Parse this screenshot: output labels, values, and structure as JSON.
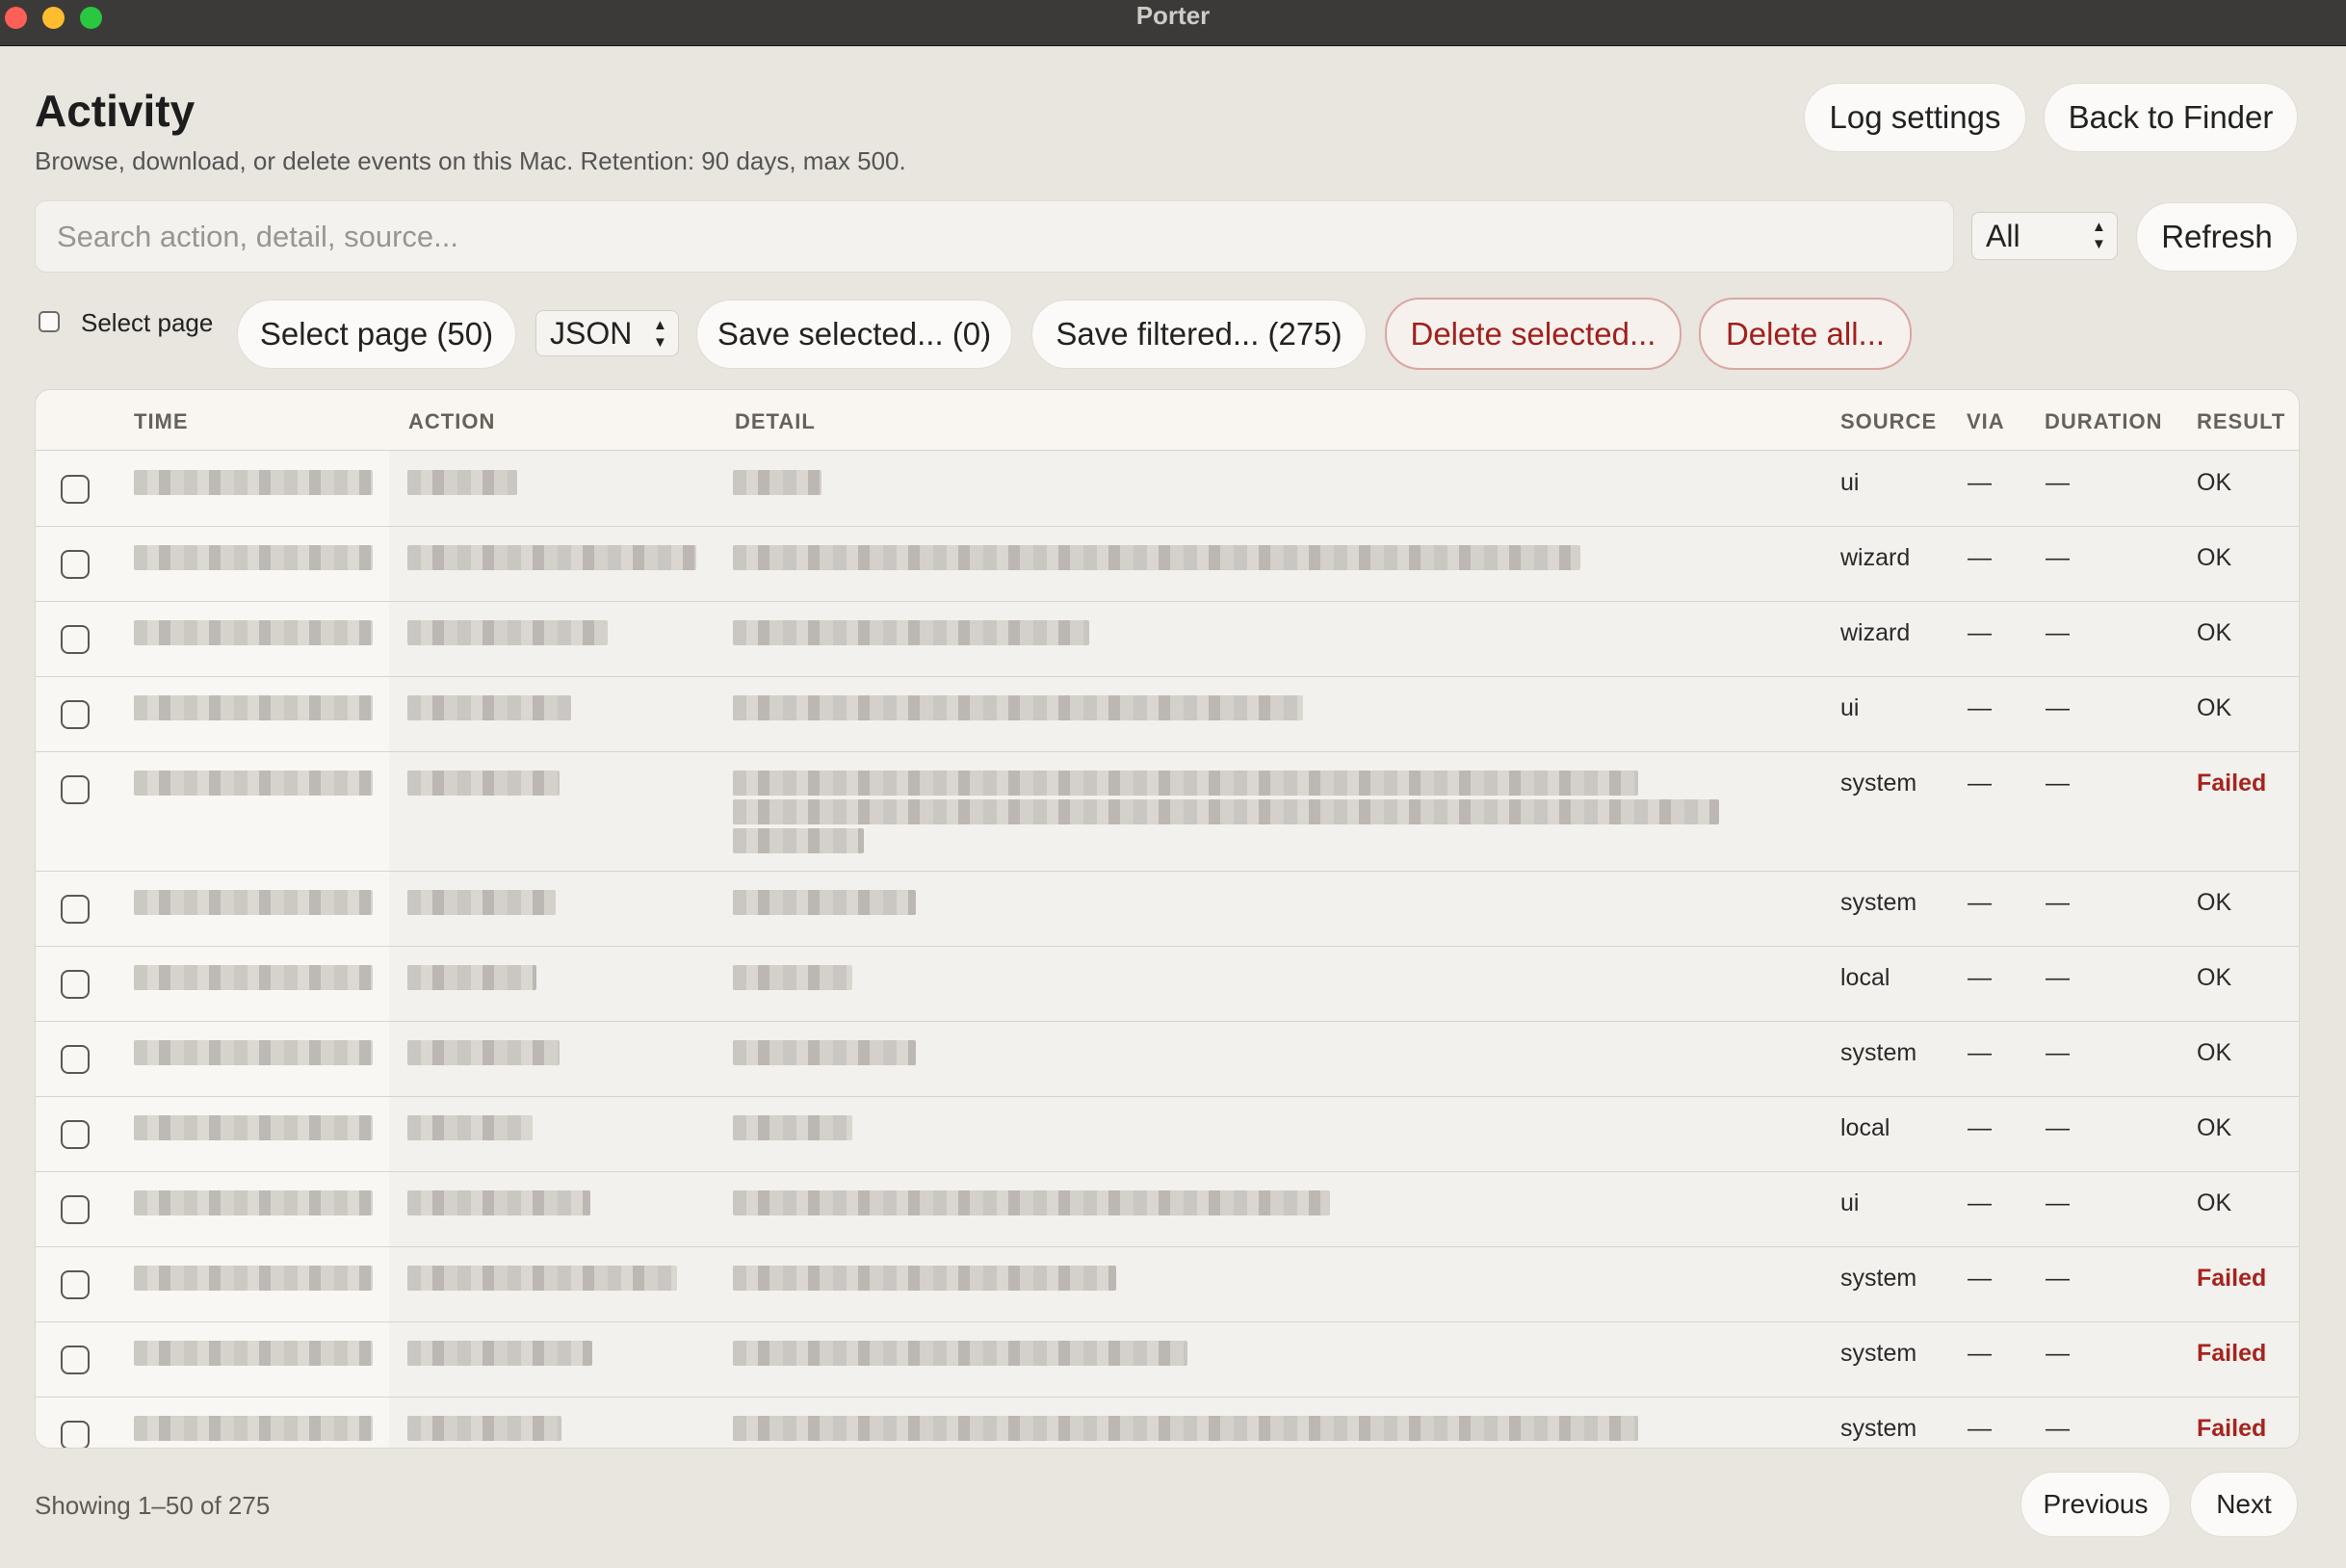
{
  "window": {
    "title": "Porter"
  },
  "header": {
    "title": "Activity",
    "subtitle": "Browse, download, or delete events on this Mac. Retention: 90 days, max 500.",
    "log_settings": "Log settings",
    "back_to_finder": "Back to Finder"
  },
  "search": {
    "placeholder": "Search action, detail, source...",
    "value": ""
  },
  "filter": {
    "selected": "All"
  },
  "refresh_label": "Refresh",
  "toolbar": {
    "select_page_checkbox_label": "Select page",
    "select_page_button": "Select page (50)",
    "format": "JSON",
    "save_selected": "Save selected... (0)",
    "save_filtered": "Save filtered... (275)",
    "delete_selected": "Delete selected...",
    "delete_all": "Delete all..."
  },
  "table": {
    "columns": [
      "TIME",
      "ACTION",
      "DETAIL",
      "SOURCE",
      "VIA",
      "DURATION",
      "RESULT"
    ],
    "rows": [
      {
        "source": "ui",
        "via": "—",
        "duration": "—",
        "result": "OK"
      },
      {
        "source": "wizard",
        "via": "—",
        "duration": "—",
        "result": "OK"
      },
      {
        "source": "wizard",
        "via": "—",
        "duration": "—",
        "result": "OK"
      },
      {
        "source": "ui",
        "via": "—",
        "duration": "—",
        "result": "OK"
      },
      {
        "source": "system",
        "via": "—",
        "duration": "—",
        "result": "Failed"
      },
      {
        "source": "system",
        "via": "—",
        "duration": "—",
        "result": "OK"
      },
      {
        "source": "local",
        "via": "—",
        "duration": "—",
        "result": "OK"
      },
      {
        "source": "system",
        "via": "—",
        "duration": "—",
        "result": "OK"
      },
      {
        "source": "local",
        "via": "—",
        "duration": "—",
        "result": "OK"
      },
      {
        "source": "ui",
        "via": "—",
        "duration": "—",
        "result": "OK"
      },
      {
        "source": "system",
        "via": "—",
        "duration": "—",
        "result": "Failed"
      },
      {
        "source": "system",
        "via": "—",
        "duration": "—",
        "result": "Failed"
      },
      {
        "source": "system",
        "via": "—",
        "duration": "—",
        "result": "Failed"
      }
    ]
  },
  "footer": {
    "showing": "Showing 1–50 of 275",
    "previous": "Previous",
    "next": "Next"
  }
}
